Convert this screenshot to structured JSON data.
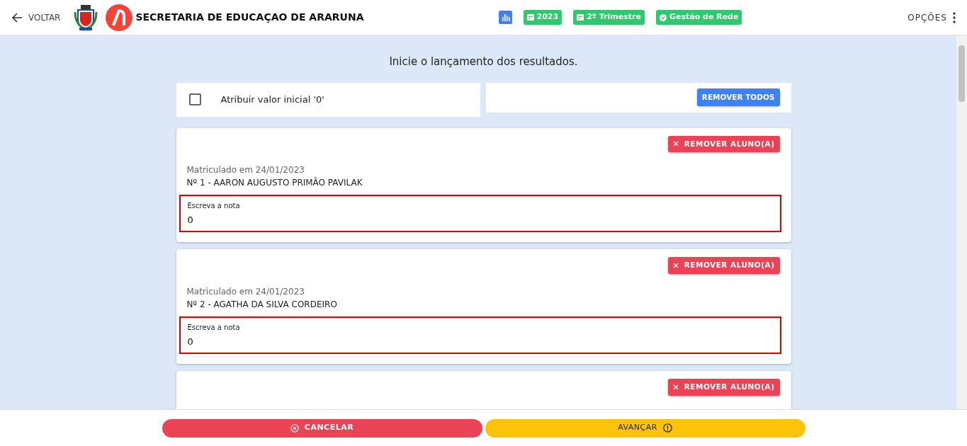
{
  "header": {
    "back_label": "VOLTAR",
    "title": "SECRETARIA DE EDUCAÇAO DE ARARUNA",
    "chips": [
      {
        "kind": "calendar",
        "label": "2023"
      },
      {
        "kind": "calendar",
        "label": "2º Trimestre"
      },
      {
        "kind": "check",
        "label": "Gestão de Rede"
      }
    ],
    "options_label": "OPÇÕES"
  },
  "intro": "Inicie o lançamento dos resultados.",
  "initial_value": {
    "label": "Atribuir valor inicial '0'",
    "checked": false
  },
  "remove_all_label": "REMOVER TODOS",
  "students": [
    {
      "remove_label": "REMOVER ALUNO(A)",
      "enrolled": "Matriculado em 24/01/2023",
      "name": "Nº 1 - AARON AUGUSTO PRIMÃO PAVILAK",
      "field_label": "Escreva a nota",
      "value": "0"
    },
    {
      "remove_label": "REMOVER ALUNO(A)",
      "enrolled": "Matriculado em 24/01/2023",
      "name": "Nº 2 - AGATHA DA SILVA CORDEIRO",
      "field_label": "Escreva a nota",
      "value": "0"
    },
    {
      "remove_label": "REMOVER ALUNO(A)"
    }
  ],
  "footer": {
    "cancel_label": "CANCELAR",
    "next_label": "AVANÇAR"
  }
}
